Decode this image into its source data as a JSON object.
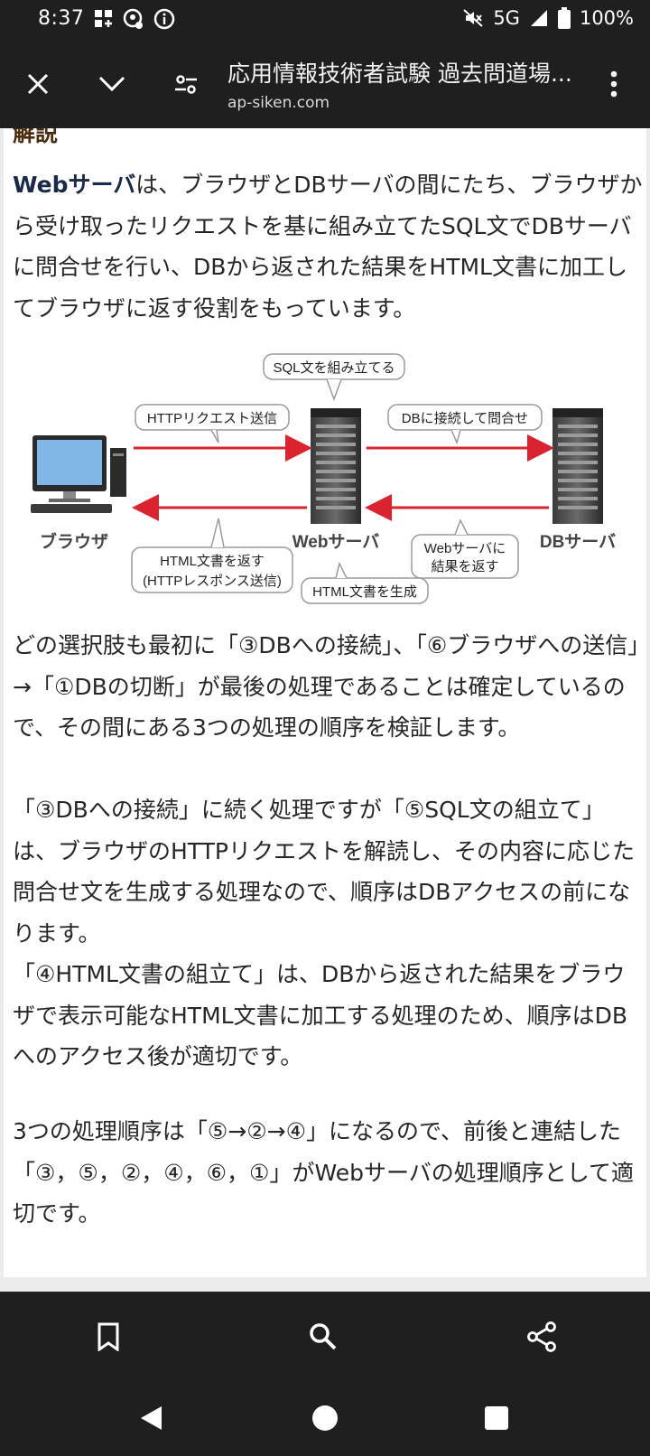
{
  "status": {
    "time": "8:37",
    "network": "5G",
    "battery": "100%"
  },
  "toolbar": {
    "title": "応用情報技術者試験 過去問道場...",
    "url": "ap-siken.com"
  },
  "article": {
    "section_heading": "解説",
    "intro_bold": "Webサーバ",
    "intro_rest": "は、ブラウザとDBサーバの間にたち、ブラウザから受け取ったリクエストを基に組み立てたSQL文でDBサーバに問合せを行い、DBから返された結果をHTML文書に加工してブラウザに返す役割をもっています。",
    "p2": "どの選択肢も最初に「③DBへの接続」、「⑥ブラウザへの送信」→「①DBの切断」が最後の処理であることは確定しているので、その間にある3つの処理の順序を検証します。",
    "p3": "「③DBへの接続」に続く処理ですが「⑤SQL文の組立て」は、ブラウザのHTTPリクエストを解読し、その内容に応じた問合せ文を生成する処理なので、順序はDBアクセスの前になります。",
    "p4": "「④HTML文書の組立て」は、DBから返された結果をブラウザで表示可能なHTML文書に加工する処理のため、順序はDBへのアクセス後が適切です。",
    "p5": "3つの処理順序は「⑤→②→④」になるので、前後と連結した「③，⑤，②，④，⑥，①」がWebサーバの処理順序として適切です。"
  },
  "diagram": {
    "label_sql": "SQL文を組み立てる",
    "label_http_req": "HTTPリクエスト送信",
    "label_db_connect": "DBに接続して問合せ",
    "label_browser": "ブラウザ",
    "label_webserver": "Webサーバ",
    "label_dbserver": "DBサーバ",
    "label_html_return_1": "HTML文書を返す",
    "label_html_return_2": "(HTTPレスポンス送信)",
    "label_web_result_1": "Webサーバに",
    "label_web_result_2": "結果を返す",
    "label_html_gen": "HTML文書を生成",
    "arrow_color": "#d9232e"
  },
  "colors": {
    "bar_bg": "#1f1f1f",
    "text": "#262626"
  }
}
